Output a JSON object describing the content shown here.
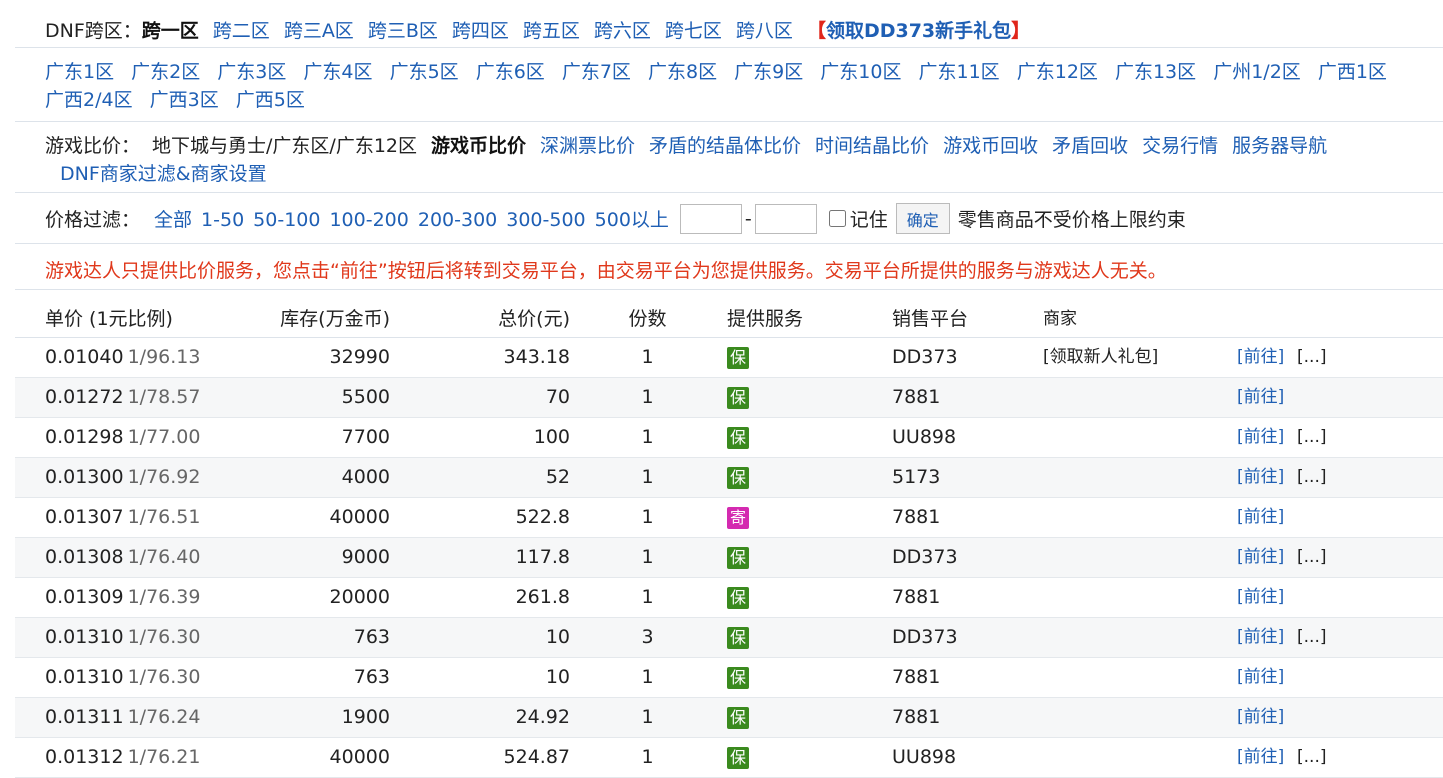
{
  "cross_server": {
    "label": "DNF跨区：",
    "current": "跨一区",
    "links": [
      "跨二区",
      "跨三A区",
      "跨三B区",
      "跨四区",
      "跨五区",
      "跨六区",
      "跨七区",
      "跨八区"
    ],
    "gift_open": "【",
    "gift_text": "领取DD373新手礼包",
    "gift_close": "】",
    "gift_color": "#e0261b"
  },
  "servers": [
    "广东1区",
    "广东2区",
    "广东3区",
    "广东4区",
    "广东5区",
    "广东6区",
    "广东7区",
    "广东8区",
    "广东9区",
    "广东10区",
    "广东11区",
    "广东12区",
    "广东13区",
    "广州1/2区",
    "广西1区",
    "广西2/4区",
    "广西3区",
    "广西5区"
  ],
  "compare": {
    "label": "游戏比价：",
    "path": "地下城与勇士/广东区/广东12区",
    "current": "游戏币比价",
    "links": [
      "深渊票比价",
      "矛盾的结晶体比价",
      "时间结晶比价",
      "游戏币回收",
      "矛盾回收",
      "交易行情",
      "服务器导航"
    ],
    "merchant_filter": "DNF商家过滤&商家设置"
  },
  "price_filter": {
    "label": "价格过滤：",
    "options": [
      "全部",
      "1-50",
      "50-100",
      "100-200",
      "200-300",
      "300-500",
      "500以上"
    ],
    "min_value": "",
    "max_value": "",
    "dash": "-",
    "remember_label": "记住",
    "confirm_label": "确定",
    "note": "零售商品不受价格上限约束"
  },
  "notice": {
    "text": "游戏达人只提供比价服务，您点击“前往”按钮后将转到交易平台，由交易平台为您提供服务。交易平台所提供的服务与游戏达人无关。",
    "color": "#e0381b"
  },
  "table": {
    "headers": {
      "price": "单价 (1元比例)",
      "stock": "库存(万金币)",
      "total": "总价(元)",
      "qty": "份数",
      "service": "提供服务",
      "platform": "销售平台",
      "merchant": "商家"
    },
    "go_label": "[前往]",
    "more_label": "[...]",
    "rows": [
      {
        "price": "0.01040",
        "ratio": "1/96.13",
        "stock": "32990",
        "total": "343.18",
        "qty": "1",
        "service": "保",
        "service_color": "#3a8a1e",
        "platform": "DD373",
        "merchant": "[领取新人礼包]",
        "more": true
      },
      {
        "price": "0.01272",
        "ratio": "1/78.57",
        "stock": "5500",
        "total": "70",
        "qty": "1",
        "service": "保",
        "service_color": "#3a8a1e",
        "platform": "7881",
        "merchant": "",
        "more": false
      },
      {
        "price": "0.01298",
        "ratio": "1/77.00",
        "stock": "7700",
        "total": "100",
        "qty": "1",
        "service": "保",
        "service_color": "#3a8a1e",
        "platform": "UU898",
        "merchant": "",
        "more": true
      },
      {
        "price": "0.01300",
        "ratio": "1/76.92",
        "stock": "4000",
        "total": "52",
        "qty": "1",
        "service": "保",
        "service_color": "#3a8a1e",
        "platform": "5173",
        "merchant": "",
        "more": true
      },
      {
        "price": "0.01307",
        "ratio": "1/76.51",
        "stock": "40000",
        "total": "522.8",
        "qty": "1",
        "service": "寄",
        "service_color": "#d42ab0",
        "platform": "7881",
        "merchant": "",
        "more": false
      },
      {
        "price": "0.01308",
        "ratio": "1/76.40",
        "stock": "9000",
        "total": "117.8",
        "qty": "1",
        "service": "保",
        "service_color": "#3a8a1e",
        "platform": "DD373",
        "merchant": "",
        "more": true
      },
      {
        "price": "0.01309",
        "ratio": "1/76.39",
        "stock": "20000",
        "total": "261.8",
        "qty": "1",
        "service": "保",
        "service_color": "#3a8a1e",
        "platform": "7881",
        "merchant": "",
        "more": false
      },
      {
        "price": "0.01310",
        "ratio": "1/76.30",
        "stock": "763",
        "total": "10",
        "qty": "3",
        "service": "保",
        "service_color": "#3a8a1e",
        "platform": "DD373",
        "merchant": "",
        "more": true
      },
      {
        "price": "0.01310",
        "ratio": "1/76.30",
        "stock": "763",
        "total": "10",
        "qty": "1",
        "service": "保",
        "service_color": "#3a8a1e",
        "platform": "7881",
        "merchant": "",
        "more": false
      },
      {
        "price": "0.01311",
        "ratio": "1/76.24",
        "stock": "1900",
        "total": "24.92",
        "qty": "1",
        "service": "保",
        "service_color": "#3a8a1e",
        "platform": "7881",
        "merchant": "",
        "more": false
      },
      {
        "price": "0.01312",
        "ratio": "1/76.21",
        "stock": "40000",
        "total": "524.87",
        "qty": "1",
        "service": "保",
        "service_color": "#3a8a1e",
        "platform": "UU898",
        "merchant": "",
        "more": true
      }
    ]
  },
  "colors": {
    "link": "#1f5fb4",
    "divider": "#dde3ea",
    "row_alt": "#f6f7f8"
  }
}
